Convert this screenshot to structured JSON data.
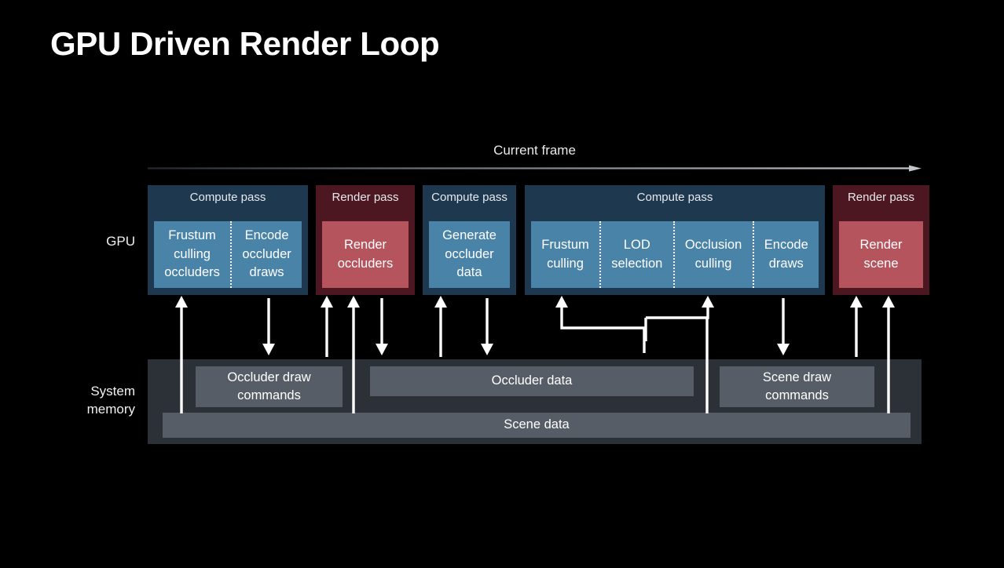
{
  "slide": {
    "title": "GPU Driven Render Loop",
    "background_color": "#000000"
  },
  "timeline": {
    "label": "Current frame",
    "direction": "left-to-right",
    "arrow_color_start": "#2a2f36",
    "arrow_color_end": "#b9bcc2"
  },
  "rows": {
    "gpu_label": "GPU",
    "system_memory_label_line1": "System",
    "system_memory_label_line2": "memory"
  },
  "colors": {
    "compute_pass_bg": "#1e3850",
    "compute_stage_bg": "#4a83a8",
    "render_pass_bg": "#4d1721",
    "render_stage_bg": "#b5545c",
    "system_memory_bg": "#2c3137",
    "memory_box_bg": "#565d66",
    "arrow_color": "#ffffff",
    "text_color": "#ffffff"
  },
  "gpu_passes": [
    {
      "id": "pass-1",
      "type": "compute",
      "title": "Compute pass",
      "stages": [
        "Frustum culling occluders",
        "Encode occluder draws"
      ],
      "stage_lines": [
        [
          "Frustum",
          "culling",
          "occluders"
        ],
        [
          "Encode",
          "occluder",
          "draws"
        ]
      ]
    },
    {
      "id": "pass-2",
      "type": "render",
      "title": "Render pass",
      "stages": [
        "Render occluders"
      ],
      "stage_lines": [
        [
          "Render",
          "occluders"
        ]
      ]
    },
    {
      "id": "pass-3",
      "type": "compute",
      "title": "Compute pass",
      "stages": [
        "Generate occluder data"
      ],
      "stage_lines": [
        [
          "Generate",
          "occluder",
          "data"
        ]
      ]
    },
    {
      "id": "pass-4",
      "type": "compute",
      "title": "Compute pass",
      "stages": [
        "Frustum culling",
        "LOD selection",
        "Occlusion culling",
        "Encode draws"
      ],
      "stage_lines": [
        [
          "Frustum",
          "culling"
        ],
        [
          "LOD",
          "selection"
        ],
        [
          "Occlusion",
          "culling"
        ],
        [
          "Encode",
          "draws"
        ]
      ]
    },
    {
      "id": "pass-5",
      "type": "render",
      "title": "Render pass",
      "stages": [
        "Render scene"
      ],
      "stage_lines": [
        [
          "Render",
          "scene"
        ]
      ]
    }
  ],
  "system_memory_boxes": [
    {
      "id": "occluder-draw-commands",
      "label": "Occluder draw commands",
      "lines": [
        "Occluder draw",
        "commands"
      ]
    },
    {
      "id": "occluder-data",
      "label": "Occluder data",
      "lines": [
        "Occluder data"
      ]
    },
    {
      "id": "scene-draw-commands",
      "label": "Scene draw commands",
      "lines": [
        "Scene draw",
        "commands"
      ]
    },
    {
      "id": "scene-data",
      "label": "Scene data",
      "lines": [
        "Scene data"
      ]
    }
  ]
}
